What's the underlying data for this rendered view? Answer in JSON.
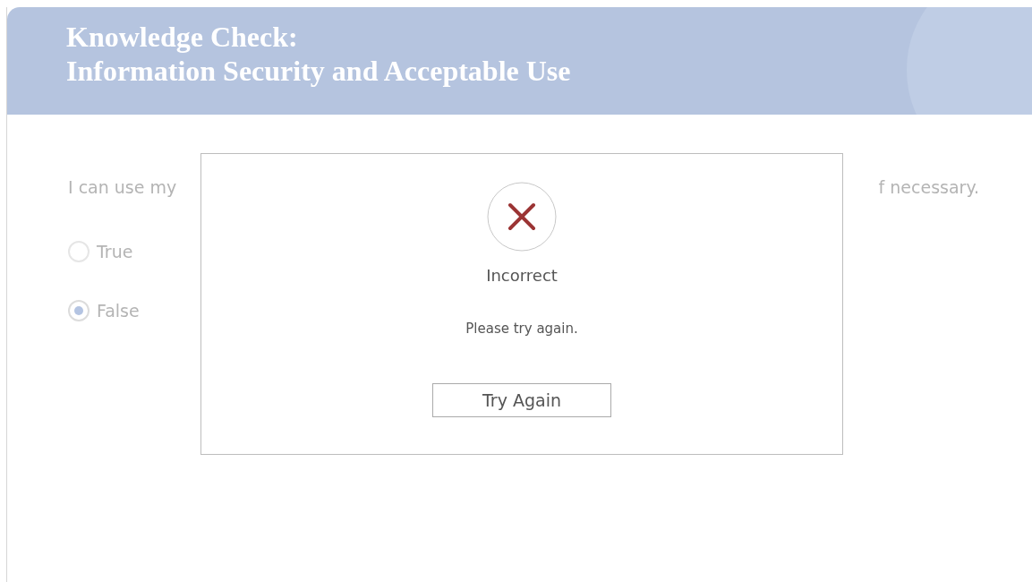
{
  "header": {
    "title_lines": [
      "Knowledge Check:",
      "Information Security and Acceptable Use"
    ]
  },
  "question": {
    "text_left": "I can use my",
    "text_right": "f necessary."
  },
  "options": [
    {
      "label": "True",
      "selected": false
    },
    {
      "label": "False",
      "selected": true
    }
  ],
  "dialog": {
    "result": "Incorrect",
    "kind": "incorrect",
    "message": "Please try again.",
    "button": "Try Again"
  }
}
